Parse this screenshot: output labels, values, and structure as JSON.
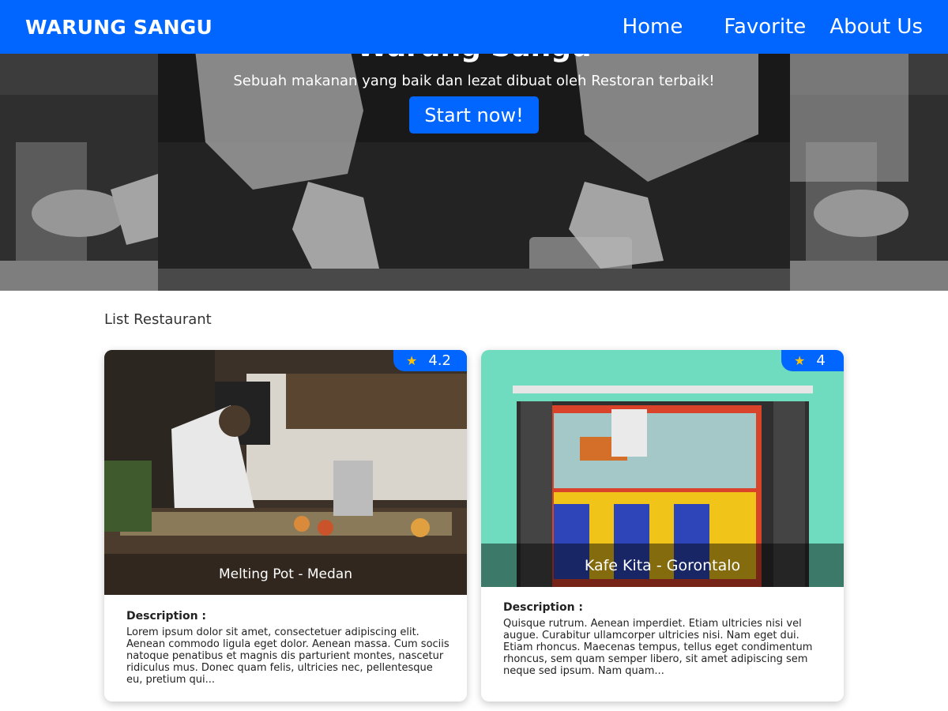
{
  "navbar": {
    "brand": "WARUNG SANGU",
    "links": [
      "Home",
      "Favorite",
      "About Us"
    ]
  },
  "hero": {
    "title": "Warung Sangu",
    "subtitle": "Sebuah makanan yang baik dan lezat dibuat oleh Restoran terbaik!",
    "cta_label": "Start now!"
  },
  "section": {
    "title": "List Restaurant"
  },
  "restaurants": [
    {
      "name": "Melting Pot - Medan",
      "rating": "4.2",
      "description_label": "Description :",
      "description": "Lorem ipsum dolor sit amet, consectetuer adipiscing elit. Aenean commodo ligula eget dolor. Aenean massa. Cum sociis natoque penatibus et magnis dis parturient montes, nascetur ridiculus mus. Donec quam felis, ultricies nec, pellentesque eu, pretium qui..."
    },
    {
      "name": "Kafe Kita - Gorontalo",
      "rating": "4",
      "description_label": "Description :",
      "description": "Quisque rutrum. Aenean imperdiet. Etiam ultricies nisi vel augue. Curabitur ullamcorper ultricies nisi. Nam eget dui. Etiam rhoncus. Maecenas tempus, tellus eget condimentum rhoncus, sem quam semper libero, sit amet adipiscing sem neque sed ipsum. Nam quam..."
    }
  ],
  "colors": {
    "primary": "#0066ff",
    "star": "#ffc107"
  },
  "icons": {
    "star": "star-icon"
  }
}
